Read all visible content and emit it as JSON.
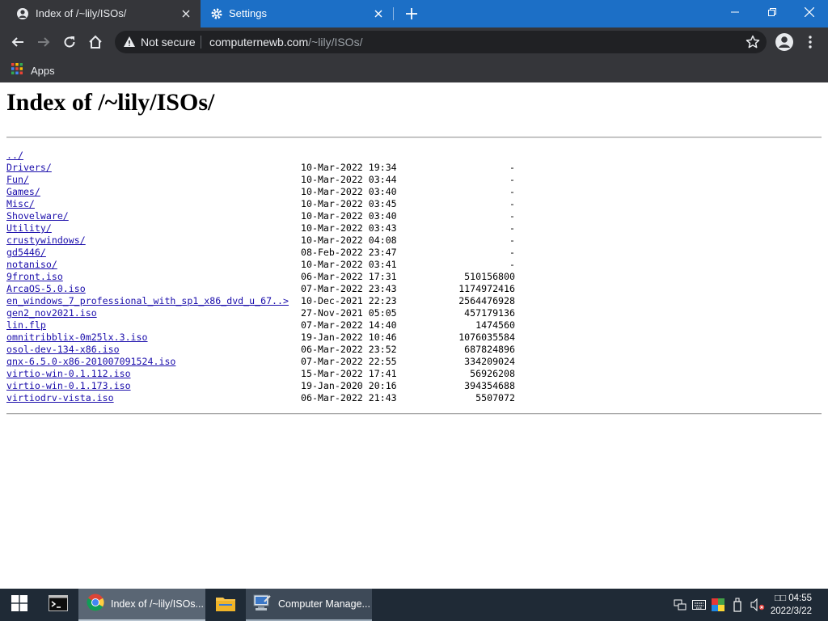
{
  "browser": {
    "tabs": [
      {
        "title": "Index of /~lily/ISOs/",
        "icon": "profile-favicon-icon",
        "active": true
      },
      {
        "title": "Settings",
        "icon": "gear-icon",
        "active": false
      }
    ],
    "omnibox": {
      "security_label": "Not secure",
      "url_host": "computernewb.com",
      "url_path": "/~lily/ISOs/"
    },
    "bookmarks": {
      "apps_label": "Apps"
    },
    "colors": {
      "tabstrip": "#1c6fc6",
      "toolbar": "#35363a",
      "link": "#1a0dab"
    }
  },
  "page": {
    "title": "Index of /~lily/ISOs/",
    "entries": [
      {
        "name": "../",
        "date": "",
        "size": ""
      },
      {
        "name": "Drivers/",
        "date": "10-Mar-2022 19:34",
        "size": "-"
      },
      {
        "name": "Fun/",
        "date": "10-Mar-2022 03:44",
        "size": "-"
      },
      {
        "name": "Games/",
        "date": "10-Mar-2022 03:40",
        "size": "-"
      },
      {
        "name": "Misc/",
        "date": "10-Mar-2022 03:45",
        "size": "-"
      },
      {
        "name": "Shovelware/",
        "date": "10-Mar-2022 03:40",
        "size": "-"
      },
      {
        "name": "Utility/",
        "date": "10-Mar-2022 03:43",
        "size": "-"
      },
      {
        "name": "crustywindows/",
        "date": "10-Mar-2022 04:08",
        "size": "-"
      },
      {
        "name": "gd5446/",
        "date": "08-Feb-2022 23:47",
        "size": "-"
      },
      {
        "name": "notaniso/",
        "date": "10-Mar-2022 03:41",
        "size": "-"
      },
      {
        "name": "9front.iso",
        "date": "06-Mar-2022 17:31",
        "size": "510156800"
      },
      {
        "name": "ArcaOS-5.0.iso",
        "date": "07-Mar-2022 23:43",
        "size": "1174972416"
      },
      {
        "name": "en_windows_7_professional_with_sp1_x86_dvd_u_67..>",
        "date": "10-Dec-2021 22:23",
        "size": "2564476928"
      },
      {
        "name": "gen2_nov2021.iso",
        "date": "27-Nov-2021 05:05",
        "size": "457179136"
      },
      {
        "name": "lin.flp",
        "date": "07-Mar-2022 14:40",
        "size": "1474560"
      },
      {
        "name": "omnitribblix-0m25lx.3.iso",
        "date": "19-Jan-2022 10:46",
        "size": "1076035584"
      },
      {
        "name": "osol-dev-134-x86.iso",
        "date": "06-Mar-2022 23:52",
        "size": "687824896"
      },
      {
        "name": "qnx-6.5.0-x86-201007091524.iso",
        "date": "07-Mar-2022 22:55",
        "size": "334209024"
      },
      {
        "name": "virtio-win-0.1.112.iso",
        "date": "15-Mar-2022 17:41",
        "size": "56926208"
      },
      {
        "name": "virtio-win-0.1.173.iso",
        "date": "19-Jan-2020 20:16",
        "size": "394354688"
      },
      {
        "name": "virtiodrv-vista.iso",
        "date": "06-Mar-2022 21:43",
        "size": "5507072"
      }
    ]
  },
  "taskbar": {
    "items": [
      {
        "label": "Index of /~lily/ISOs...",
        "icon": "chrome-icon"
      },
      {
        "label": "Computer Manage...",
        "icon": "computer-management-icon"
      }
    ],
    "clock": {
      "time": "□□ 04:55",
      "date": "2022/3/22"
    }
  }
}
